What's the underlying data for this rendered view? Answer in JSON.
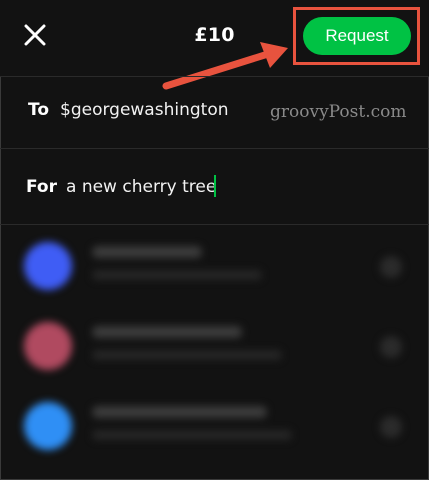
{
  "header": {
    "amount": "£10",
    "request_label": "Request"
  },
  "to_field": {
    "label": "To",
    "value": "$georgewashington"
  },
  "for_field": {
    "label": "For",
    "value": "a new cherry tree"
  },
  "watermark": "groovyPost.com",
  "contacts": [
    {
      "avatar_color": "#3f5df5"
    },
    {
      "avatar_color": "#b04a60"
    },
    {
      "avatar_color": "#2f8ff5"
    }
  ],
  "colors": {
    "accent": "#00c244",
    "highlight": "#e8533e",
    "background": "#121212"
  }
}
